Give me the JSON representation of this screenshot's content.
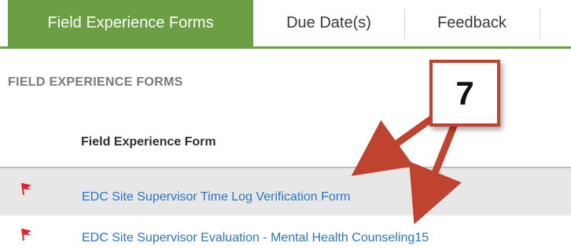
{
  "tabs": [
    {
      "label": "Field Experience Forms",
      "active": true
    },
    {
      "label": "Due Date(s)",
      "active": false
    },
    {
      "label": "Feedback",
      "active": false
    }
  ],
  "section": {
    "heading": "FIELD EXPERIENCE FORMS"
  },
  "table": {
    "column_header": "Field Experience Form",
    "rows": [
      {
        "flag_icon": "flag-icon",
        "label": "EDC Site Supervisor Time Log Verification Form"
      },
      {
        "flag_icon": "flag-icon",
        "label": "EDC Site Supervisor Evaluation - Mental Health Counseling15"
      }
    ]
  },
  "callout": {
    "number": "7"
  },
  "colors": {
    "tab_active": "#6a9f43",
    "link": "#2c75c8",
    "flag": "#e0242a",
    "callout_border": "#c0432f"
  }
}
